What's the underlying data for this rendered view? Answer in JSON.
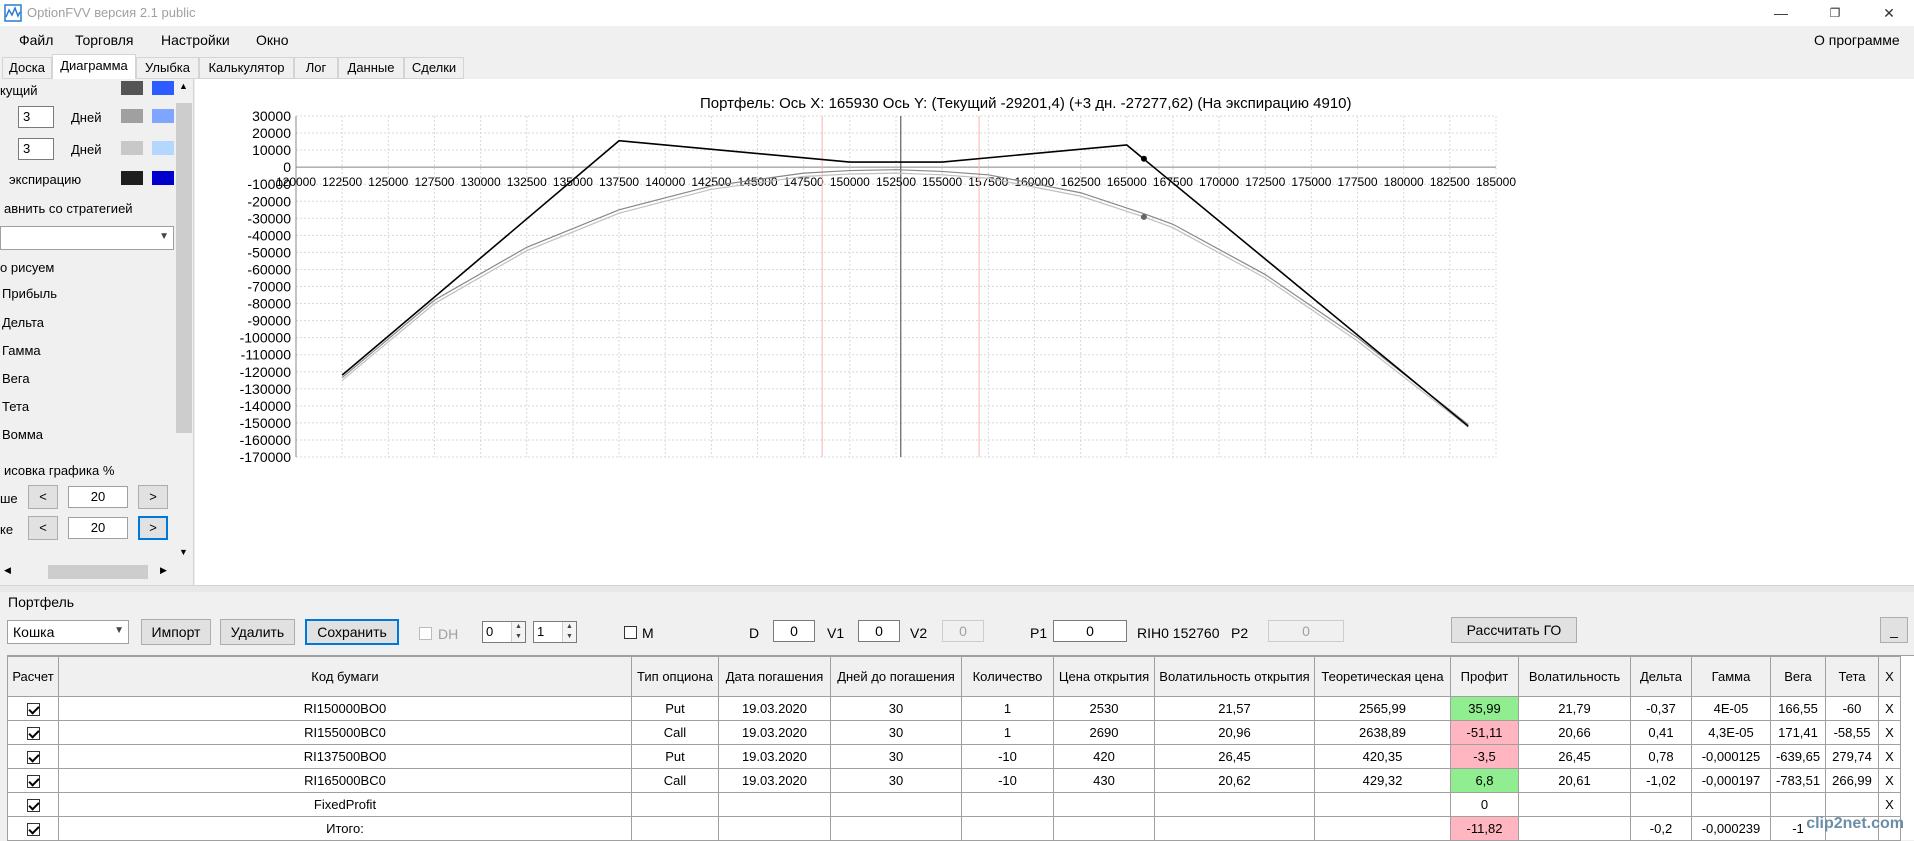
{
  "window": {
    "title": "OptionFVV версия 2.1 public",
    "minimize": "—",
    "maximize": "❐",
    "close": "✕"
  },
  "menu": {
    "items": [
      "Файл",
      "Торговля",
      "Настройки",
      "Окно"
    ],
    "about": "О программе"
  },
  "tabs": [
    "Доска",
    "Диаграмма",
    "Улыбка",
    "Калькулятор",
    "Лог",
    "Данные",
    "Сделки"
  ],
  "active_tab": "Диаграмма",
  "left_panel": {
    "current_label": "кущий",
    "days1_value": "3",
    "days1_label": "Дней",
    "days2_value": "3",
    "days2_label": "Дней",
    "expiry_label": "экспирацию",
    "compare_label": "авнить со стратегией",
    "compare_value": "",
    "draw_label": "о рисуем",
    "options": [
      "Прибыль",
      "Дельта",
      "Гамма",
      "Вега",
      "Тета",
      "Вомма"
    ],
    "scale_label": "исовка графика %",
    "upper_label": "ше",
    "upper_value": "20",
    "lower_label": "ке",
    "lower_value": "20",
    "btn_left": "<",
    "btn_right": ">",
    "swatch_colors": [
      [
        "#555555",
        "#2d5bff"
      ],
      [
        "#a0a0a0",
        "#7fa6ff"
      ],
      [
        "#c8c8c8",
        "#b3d7ff"
      ],
      [
        "#1e1e1e",
        "#0000cc"
      ]
    ]
  },
  "chart_data": {
    "type": "line",
    "title": "Портфель: Ось X: 165930 Ось Y:  (Текущий -29201,4)  (+3 дн. -27277,62)  (На экспирацию 4910)",
    "x_ticks": [
      120000,
      122500,
      125000,
      127500,
      130000,
      132500,
      135000,
      137500,
      140000,
      142500,
      145000,
      147500,
      150000,
      152500,
      155000,
      157500,
      160000,
      162500,
      165000,
      167500,
      170000,
      172500,
      175000,
      177500,
      180000,
      182500,
      185000
    ],
    "y_ticks": [
      30000,
      20000,
      10000,
      0,
      -10000,
      -20000,
      -30000,
      -40000,
      -50000,
      -60000,
      -70000,
      -80000,
      -90000,
      -100000,
      -110000,
      -120000,
      -130000,
      -140000,
      -150000,
      -160000,
      -170000
    ],
    "xlim": [
      120000,
      185000
    ],
    "ylim": [
      -170000,
      30000
    ],
    "grid": true,
    "vertical_markers": [
      {
        "x": 152760,
        "color": "#404040"
      },
      {
        "x": 148500,
        "color": "#ffb0b0"
      },
      {
        "x": 157000,
        "color": "#ffb0b0"
      }
    ],
    "series": [
      {
        "color": "#000000",
        "x": [
          122500,
          137500,
          138000,
          150000,
          155000,
          165000,
          183500
        ],
        "y": [
          -122000,
          15500,
          15000,
          3000,
          3000,
          13000,
          -152000
        ]
      },
      {
        "color": "#888888",
        "x": [
          122500,
          127500,
          132500,
          137500,
          142500,
          147500,
          150000,
          152500,
          155000,
          157500,
          162500,
          165930,
          167500,
          172500,
          177500,
          183500
        ],
        "y": [
          -123500,
          -78000,
          -47000,
          -25000,
          -11000,
          -3500,
          -2000,
          -1500,
          -2500,
          -4500,
          -15000,
          -27300,
          -33500,
          -63000,
          -100000,
          -151000
        ]
      },
      {
        "color": "#c0c0c0",
        "x": [
          122500,
          127500,
          132500,
          137500,
          142500,
          147500,
          150000,
          152500,
          155000,
          157500,
          162500,
          165930,
          167500,
          172500,
          177500,
          183500
        ],
        "y": [
          -125000,
          -80000,
          -49000,
          -27000,
          -13000,
          -5500,
          -4000,
          -3500,
          -4500,
          -6500,
          -17000,
          -29200,
          -35500,
          -65000,
          -102000,
          -152500
        ]
      }
    ],
    "cursor_points": [
      {
        "x": 165930,
        "y": 4910,
        "color": "#000000"
      },
      {
        "x": 165930,
        "y": -29201.4,
        "color": "#666666"
      }
    ]
  },
  "portfolio": {
    "label": "Портфель",
    "selected": "Кошка",
    "import_btn": "Импорт",
    "delete_btn": "Удалить",
    "save_btn": "Сохранить",
    "dh_label": "DH",
    "spin1": "0",
    "spin2": "1",
    "m_label": "M",
    "d_label": "D",
    "d_value": "0",
    "v1_label": "V1",
    "v1_value": "0",
    "v2_label": "V2",
    "v2_value": "0",
    "p1_label": "P1",
    "p1_value": "0",
    "rih_label": "RIH0 152760",
    "p2_label": "P2",
    "p2_value": "0",
    "calc_go_btn": "Рассчитать ГО",
    "minimize_btn": "_"
  },
  "table": {
    "headers": [
      "Расчет",
      "Код бумаги",
      "Тип опциона",
      "Дата погашения",
      "Дней до погашения",
      "Количество",
      "Цена открытия",
      "Волатильность открытия",
      "Теоретическая цена",
      "Профит",
      "Волатильность",
      "Дельта",
      "Гамма",
      "Вега",
      "Тета",
      "X"
    ],
    "rows": [
      {
        "code": "RI150000BO0",
        "type": "Put",
        "date": "19.03.2020",
        "days": "30",
        "qty": "1",
        "price": "2530",
        "vol_open": "21,57",
        "theo": "2565,99",
        "profit": "35,99",
        "profit_sign": "pos",
        "vol": "21,79",
        "delta": "-0,37",
        "gamma": "4E-05",
        "vega": "166,55",
        "theta": "-60",
        "x": "X"
      },
      {
        "code": "RI155000BC0",
        "type": "Call",
        "date": "19.03.2020",
        "days": "30",
        "qty": "1",
        "price": "2690",
        "vol_open": "20,96",
        "theo": "2638,89",
        "profit": "-51,11",
        "profit_sign": "neg",
        "vol": "20,66",
        "delta": "0,41",
        "gamma": "4,3E-05",
        "vega": "171,41",
        "theta": "-58,55",
        "x": "X"
      },
      {
        "code": "RI137500BO0",
        "type": "Put",
        "date": "19.03.2020",
        "days": "30",
        "qty": "-10",
        "price": "420",
        "vol_open": "26,45",
        "theo": "420,35",
        "profit": "-3,5",
        "profit_sign": "neg",
        "vol": "26,45",
        "delta": "0,78",
        "gamma": "-0,000125",
        "vega": "-639,65",
        "theta": "279,74",
        "x": "X"
      },
      {
        "code": "RI165000BC0",
        "type": "Call",
        "date": "19.03.2020",
        "days": "30",
        "qty": "-10",
        "price": "430",
        "vol_open": "20,62",
        "theo": "429,32",
        "profit": "6,8",
        "profit_sign": "pos",
        "vol": "20,61",
        "delta": "-1,02",
        "gamma": "-0,000197",
        "vega": "-783,51",
        "theta": "266,99",
        "x": "X"
      },
      {
        "code": "FixedProfit",
        "type": "",
        "date": "",
        "days": "",
        "qty": "",
        "price": "",
        "vol_open": "",
        "theo": "",
        "profit": "0",
        "profit_sign": "none",
        "vol": "",
        "delta": "",
        "gamma": "",
        "vega": "",
        "theta": "",
        "x": "X"
      },
      {
        "code": "Итого:",
        "type": "",
        "date": "",
        "days": "",
        "qty": "",
        "price": "",
        "vol_open": "",
        "theo": "",
        "profit": "-11,82",
        "profit_sign": "neg",
        "vol": "",
        "delta": "-0,2",
        "gamma": "-0,000239",
        "vega": "-1",
        "theta": "",
        "x": ""
      }
    ]
  },
  "watermark": "clip2net.com"
}
